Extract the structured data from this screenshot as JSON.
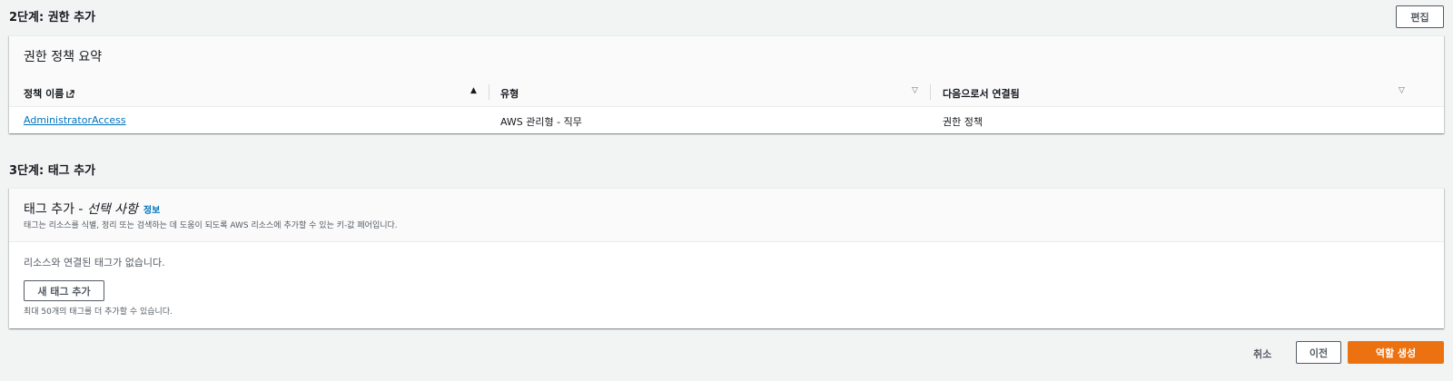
{
  "step2": {
    "header": "2단계: 권한 추가",
    "edit_label": "편집",
    "panel_title": "권한 정책 요약",
    "columns": {
      "policy_name": "정책 이름",
      "type": "유형",
      "attached_as": "다음으로서 연결됨"
    },
    "rows": [
      {
        "policy_name": "AdministratorAccess",
        "type": "AWS 관리형 - 직무",
        "attached_as": "권한 정책"
      }
    ]
  },
  "step3": {
    "header": "3단계: 태그 추가",
    "panel_title_prefix": "태그 추가 - ",
    "panel_title_italic": "선택 사항",
    "info_link": "정보",
    "description": "태그는 리소스를 식별, 정리 또는 검색하는 데 도움이 되도록 AWS 리소스에 추가할 수 있는 키-값 페어입니다.",
    "no_tags": "리소스와 연결된 태그가 없습니다.",
    "add_tag_label": "새 태그 추가",
    "tag_limit": "최대 50개의 태그를 더 추가할 수 있습니다."
  },
  "footer": {
    "cancel_label": "취소",
    "previous_label": "이전",
    "create_label": "역할 생성"
  },
  "colors": {
    "primary_button": "#ec7211",
    "link": "#0073bb",
    "background": "#f2f3f3"
  }
}
